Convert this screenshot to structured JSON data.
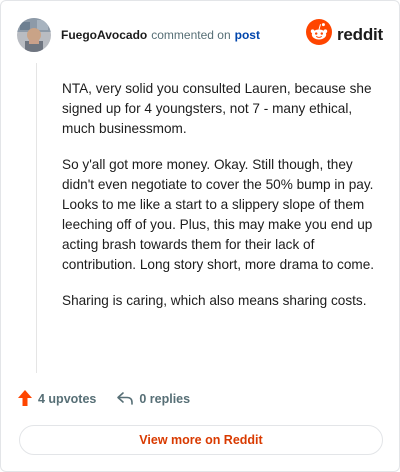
{
  "comment": {
    "author": "FuegoAvocado",
    "verb": "commented on",
    "post_link": "post",
    "paragraphs": [
      "NTA, very solid you consulted Lauren, because she signed up for 4 youngsters, not 7 - many ethical, much businessmom.",
      "So y'all got more money. Okay. Still though, they didn't even negotiate to cover the 50% bump in pay. Looks to me like a start to a slippery slope of them leeching off of you. Plus, this may make you end up acting brash towards them for their lack of contribution. Long story short, more drama to come.",
      "Sharing is caring, which also means sharing costs."
    ]
  },
  "brand": {
    "wordmark": "reddit",
    "icon": "reddit-snoo-icon",
    "color": "#ff4500"
  },
  "actions": {
    "upvotes_label": "4 upvotes",
    "upvote_icon": "upvote-arrow-icon",
    "upvote_color": "#ff4500",
    "replies_label": "0 replies",
    "reply_icon": "reply-arrow-icon"
  },
  "footer": {
    "view_more_label": "View more on Reddit",
    "accent": "#d93a00"
  }
}
